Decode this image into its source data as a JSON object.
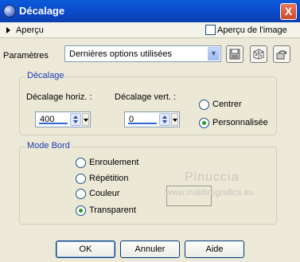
{
  "window": {
    "title": "Décalage",
    "close_glyph": "X"
  },
  "preview": {
    "label": "Aperçu",
    "preview_image_label": "Aperçu de l'image",
    "preview_image_checked": false
  },
  "settings": {
    "label": "Paramètres",
    "preset_value": "Dernières options utilisées",
    "toolbar_icons": [
      "save-icon",
      "dice-icon",
      "reset-icon"
    ]
  },
  "offset_group": {
    "title": "Décalage",
    "horizontal": {
      "label": "Décalage horiz. :",
      "value": "400"
    },
    "vertical": {
      "label": "Décalage vert. :",
      "value": "0"
    },
    "center_label": "Centrer",
    "custom_label": "Personnalisée",
    "selected": "custom"
  },
  "edge_group": {
    "title": "Mode Bord",
    "options": [
      "Enroulement",
      "Répétition",
      "Couleur",
      "Transparent"
    ],
    "selected": "Transparent"
  },
  "watermark": {
    "name": "Pinuccia",
    "url": "www.maidiregrafica.eu"
  },
  "buttons": {
    "ok": "OK",
    "cancel": "Annuler",
    "help": "Aide"
  },
  "colors": {
    "title_bar": "#0a49c8",
    "dialog_bg": "#ece9d8",
    "group_title": "#1c3ab8",
    "radio_dot": "#21a121"
  }
}
